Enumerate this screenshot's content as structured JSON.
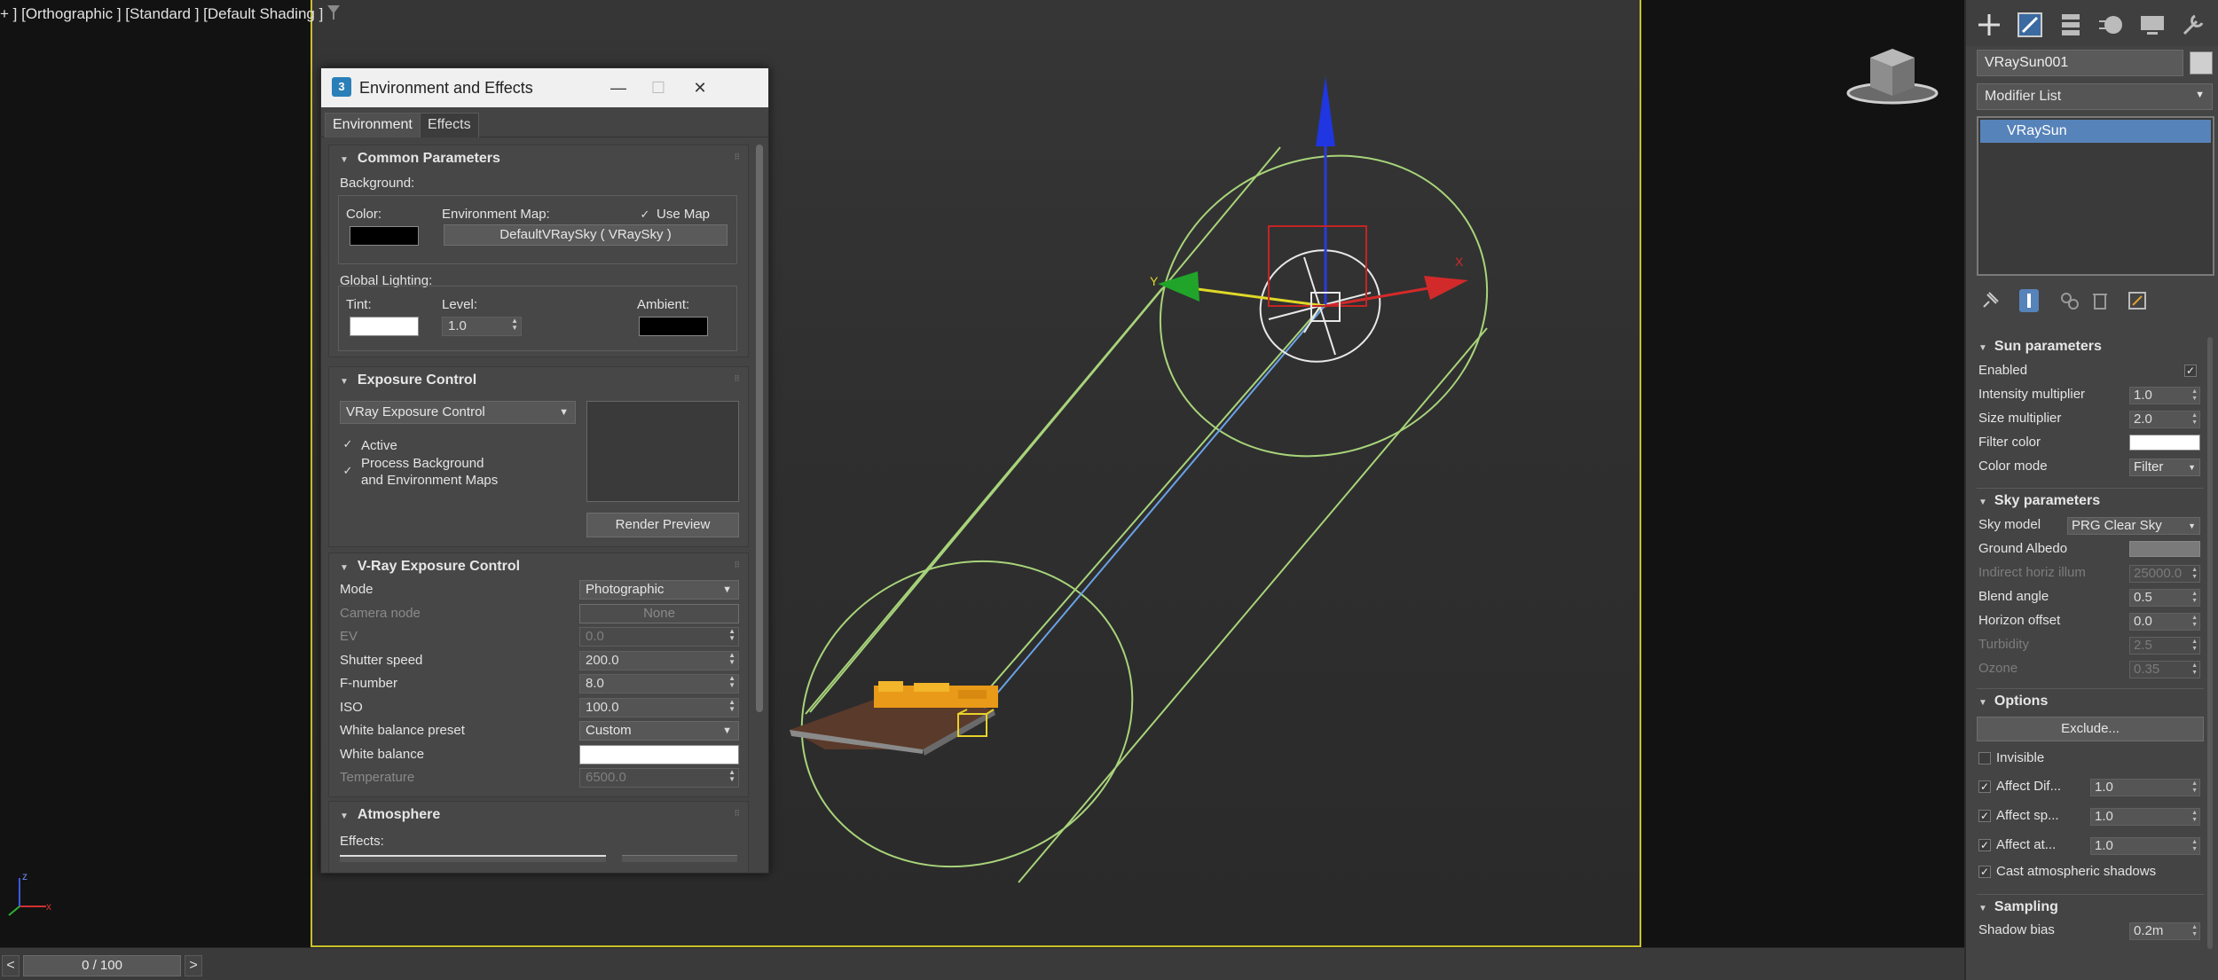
{
  "viewport": {
    "label": "+ ] [Orthographic ] [Standard ] [Default Shading ]",
    "axis_x": "x",
    "axis_z": "z",
    "gizmo_axis_x": "X",
    "gizmo_axis_y": "Y"
  },
  "timeline": {
    "prev": "<",
    "next": ">",
    "frame": "0 / 100"
  },
  "dialog": {
    "title": "Environment and Effects",
    "tabs": [
      "Environment",
      "Effects"
    ],
    "common": {
      "header": "Common Parameters",
      "background": "Background:",
      "color": "Color:",
      "environment_map": "Environment Map:",
      "use_map": "Use Map",
      "map_button": "DefaultVRaySky  ( VRaySky )",
      "global_lighting": "Global Lighting:",
      "tint": "Tint:",
      "level": "Level:",
      "level_value": "1.0",
      "ambient": "Ambient:",
      "background_color": "#000000",
      "tint_color": "#ffffff",
      "ambient_color": "#000000"
    },
    "exposure": {
      "header": "Exposure Control",
      "type": "VRay Exposure Control",
      "active": "Active",
      "process_line1": "Process Background",
      "process_line2": "and Environment Maps",
      "render_preview": "Render Preview"
    },
    "vray_exposure": {
      "header": "V-Ray Exposure Control",
      "rows": [
        {
          "label": "Mode",
          "value": "Photographic",
          "kind": "dropdown",
          "enabled": true
        },
        {
          "label": "Camera node",
          "value": "None",
          "kind": "button",
          "enabled": false
        },
        {
          "label": "EV",
          "value": "0.0",
          "kind": "spinner",
          "enabled": false
        },
        {
          "label": "Shutter speed",
          "value": "200.0",
          "kind": "spinner",
          "enabled": true
        },
        {
          "label": "F-number",
          "value": "8.0",
          "kind": "spinner",
          "enabled": true
        },
        {
          "label": "ISO",
          "value": "100.0",
          "kind": "spinner",
          "enabled": true
        },
        {
          "label": "White balance preset",
          "value": "Custom",
          "kind": "dropdown",
          "enabled": true
        },
        {
          "label": "White balance",
          "value": "",
          "kind": "swatch",
          "enabled": true
        },
        {
          "label": "Temperature",
          "value": "6500.0",
          "kind": "spinner",
          "enabled": false
        }
      ]
    },
    "atmosphere": {
      "header": "Atmosphere",
      "effects": "Effects:"
    }
  },
  "command_panel": {
    "object_name": "VRaySun001",
    "modifier_list": "Modifier List",
    "stack_item": "VRaySun",
    "sun": {
      "header": "Sun parameters",
      "rows": [
        {
          "label": "Enabled",
          "value": "✓",
          "kind": "check",
          "enabled": true
        },
        {
          "label": "Intensity multiplier",
          "value": "1.0",
          "kind": "spinner",
          "enabled": true
        },
        {
          "label": "Size multiplier",
          "value": "2.0",
          "kind": "spinner",
          "enabled": true
        },
        {
          "label": "Filter color",
          "value": "",
          "kind": "swatch",
          "enabled": true
        },
        {
          "label": "Color mode",
          "value": "Filter",
          "kind": "dropdown",
          "enabled": true
        }
      ]
    },
    "sky": {
      "header": "Sky parameters",
      "rows": [
        {
          "label": "Sky model",
          "value": "PRG Clear Sky",
          "kind": "dropdown",
          "enabled": true
        },
        {
          "label": "Ground Albedo",
          "value": "",
          "kind": "swatch-gray",
          "enabled": true
        },
        {
          "label": "Indirect horiz illum",
          "value": "25000.0",
          "kind": "spinner",
          "enabled": false
        },
        {
          "label": "Blend angle",
          "value": "0.5",
          "kind": "spinner",
          "enabled": true
        },
        {
          "label": "Horizon offset",
          "value": "0.0",
          "kind": "spinner",
          "enabled": true
        },
        {
          "label": "Turbidity",
          "value": "2.5",
          "kind": "spinner",
          "enabled": false
        },
        {
          "label": "Ozone",
          "value": "0.35",
          "kind": "spinner",
          "enabled": false
        }
      ]
    },
    "options": {
      "header": "Options",
      "exclude": "Exclude...",
      "invisible": "Invisible",
      "affect_rows": [
        {
          "label": "Affect Dif...",
          "value": "1.0"
        },
        {
          "label": "Affect sp...",
          "value": "1.0"
        },
        {
          "label": "Affect at...",
          "value": "1.0"
        }
      ],
      "cast_shadows": "Cast atmospheric shadows"
    },
    "sampling": {
      "header": "Sampling",
      "shadow_bias": "Shadow bias",
      "shadow_bias_value": "0.2m"
    }
  },
  "colors": {
    "safe_frame": "#c9c02a",
    "selection_blue": "#5683b9",
    "light_cone": "#a8d47a"
  }
}
